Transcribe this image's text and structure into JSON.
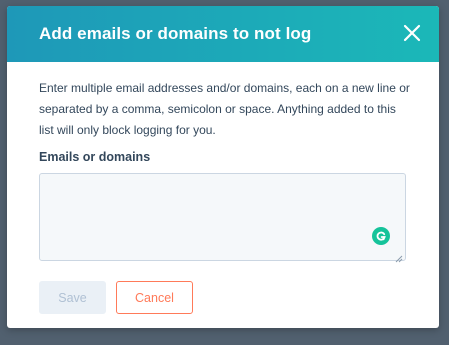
{
  "modal": {
    "title": "Add emails or domains to not log",
    "description": "Enter multiple email addresses and/or domains, each on a new line or separated by a comma, semicolon or space. Anything added to this list will only block logging for you.",
    "field_label": "Emails or domains",
    "field_value": "",
    "save_label": "Save",
    "cancel_label": "Cancel"
  },
  "icons": {
    "close": "close-icon",
    "grammarly": "grammarly-icon",
    "resize": "resize-handle-icon"
  },
  "colors": {
    "header_start": "#1e98b8",
    "header_end": "#1bb8b8",
    "accent": "#ff7a59",
    "text": "#33475b",
    "grammarly": "#15c39a"
  }
}
